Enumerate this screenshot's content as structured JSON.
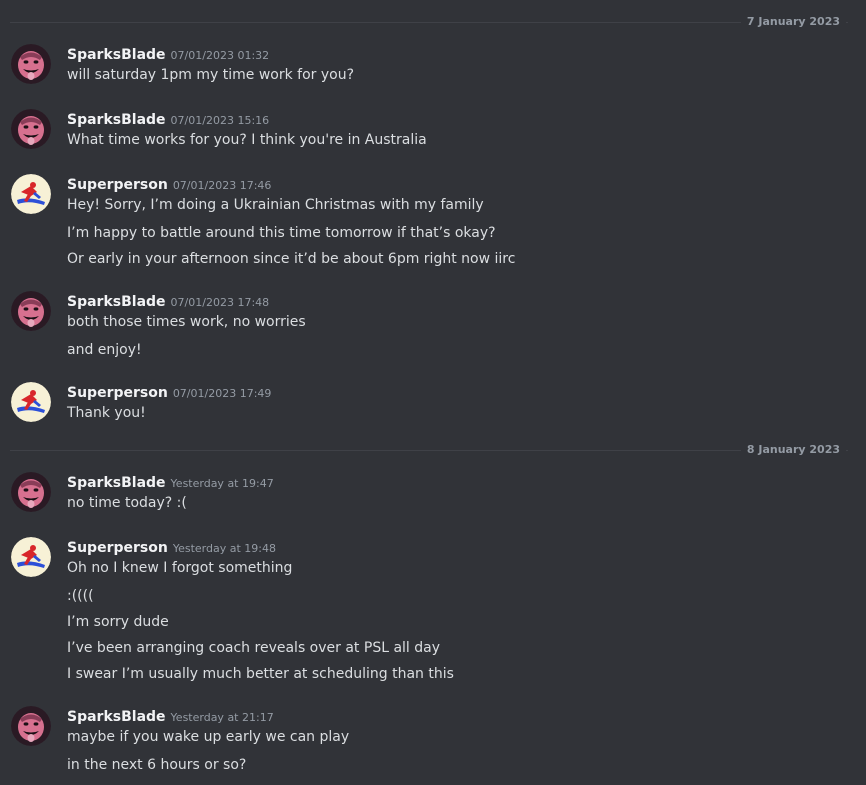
{
  "dividers": [
    {
      "date": "7 January 2023"
    },
    {
      "date": "8 January 2023"
    }
  ],
  "messages": [
    {
      "author": "SparksBlade",
      "timestamp": "07/01/2023 01:32",
      "avatar": "sparksblade-avatar",
      "lines": [
        "will saturday 1pm my time work for you?"
      ]
    },
    {
      "author": "SparksBlade",
      "timestamp": "07/01/2023 15:16",
      "avatar": "sparksblade-avatar",
      "lines": [
        "What time works for you? I think you're in Australia"
      ]
    },
    {
      "author": "Superperson",
      "timestamp": "07/01/2023 17:46",
      "avatar": "superperson-avatar",
      "lines": [
        "Hey! Sorry, I’m doing a Ukrainian Christmas with my family",
        "I’m happy to battle around this time tomorrow if that’s okay?",
        "Or early in your afternoon since it’d be about 6pm right now iirc"
      ]
    },
    {
      "author": "SparksBlade",
      "timestamp": "07/01/2023 17:48",
      "avatar": "sparksblade-avatar",
      "lines": [
        "both those times work, no worries",
        "and enjoy!"
      ]
    },
    {
      "author": "Superperson",
      "timestamp": "07/01/2023 17:49",
      "avatar": "superperson-avatar",
      "lines": [
        "Thank you!"
      ]
    },
    {
      "author": "SparksBlade",
      "timestamp": "Yesterday at 19:47",
      "avatar": "sparksblade-avatar",
      "lines": [
        "no time today? :("
      ]
    },
    {
      "author": "Superperson",
      "timestamp": "Yesterday at 19:48",
      "avatar": "superperson-avatar",
      "lines": [
        "Oh no I knew I forgot something",
        ":((((",
        "I’m sorry dude",
        "I’ve been arranging coach reveals over at PSL all day",
        "I swear I’m usually much better at scheduling than this"
      ]
    },
    {
      "author": "SparksBlade",
      "timestamp": "Yesterday at 21:17",
      "avatar": "sparksblade-avatar",
      "lines": [
        "maybe if you wake up early we can play",
        "in the next 6 hours or so?"
      ]
    }
  ],
  "colors": {
    "background": "#313338",
    "author": "#f2f3f5",
    "text": "#dbdee1",
    "muted": "#949ba4"
  }
}
